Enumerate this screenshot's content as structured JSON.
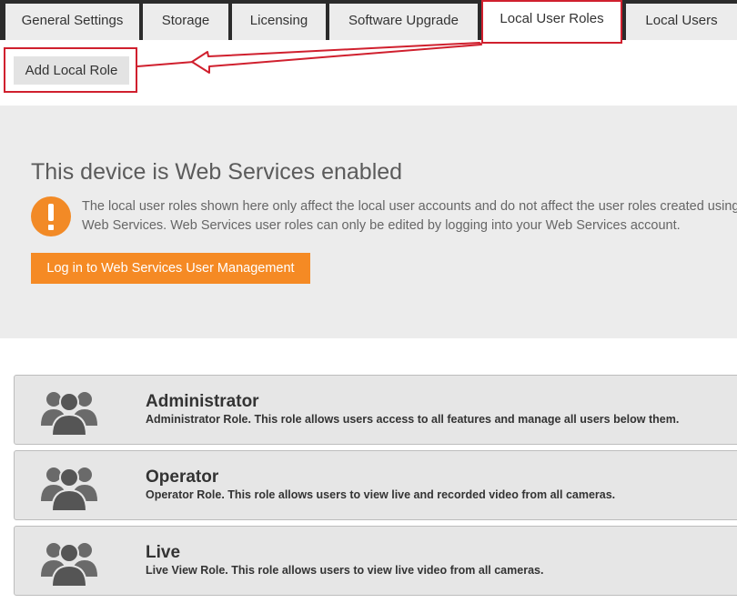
{
  "tabs": [
    {
      "label": "General Settings"
    },
    {
      "label": "Storage"
    },
    {
      "label": "Licensing"
    },
    {
      "label": "Software Upgrade"
    },
    {
      "label": "Local User Roles",
      "active": true
    },
    {
      "label": "Local Users"
    }
  ],
  "toolbar": {
    "add_role_label": "Add Local Role"
  },
  "banner": {
    "title": "This device is Web Services enabled",
    "text": "The local user roles shown here only affect the local user accounts and do not affect the user roles created using Web Services. Web Services user roles can only be edited by logging into your Web Services account.",
    "button_label": "Log in to Web Services User Management",
    "icon": "exclamation-icon"
  },
  "roles": [
    {
      "name": "Administrator",
      "description": "Administrator Role. This role allows users access to all features and manage all users below them."
    },
    {
      "name": "Operator",
      "description": "Operator Role. This role allows users to view live and recorded video from all cameras."
    },
    {
      "name": "Live",
      "description": "Live View Role. This role allows users to view live video from all cameras."
    }
  ],
  "colors": {
    "accent": "#f58a24",
    "annotation": "#d0202e",
    "tab_bar": "#2b2b2b"
  }
}
